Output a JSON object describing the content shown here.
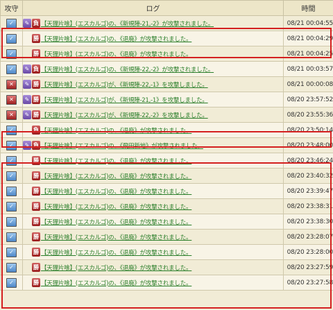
{
  "headers": {
    "attack_defense": "攻守",
    "log": "ログ",
    "time": "時間"
  },
  "rows": [
    {
      "mode": "def",
      "icon": "pen",
      "result": "負",
      "text": "【天狸片喰】(エスカルゴ)の、《新規陣-21,-2》が攻撃されました。",
      "time": "08/21 00:04:55"
    },
    {
      "mode": "def",
      "icon": "",
      "result": "勝",
      "text": "【天狸片喰】(エスカルゴ)の、《退廃》が攻撃されました。",
      "time": "08/21 00:04:29"
    },
    {
      "mode": "def",
      "icon": "",
      "result": "勝",
      "text": "【天狸片喰】(エスカルゴ)の、《退廃》が攻撃されました。",
      "time": "08/21 00:04:25"
    },
    {
      "mode": "def",
      "icon": "pen",
      "result": "負",
      "text": "【天狸片喰】(エスカルゴ)の、《新規陣-22,-2》が攻撃されました。",
      "time": "08/21 00:03:57"
    },
    {
      "mode": "atk",
      "icon": "pen",
      "result": "勝",
      "text": "【天狸片喰】(エスカルゴ)が、《新規陣-22,-1》を攻撃しました。",
      "time": "08/21 00:00:08"
    },
    {
      "mode": "atk",
      "icon": "pen",
      "result": "勝",
      "text": "【天狸片喰】(エスカルゴ)が、《新規陣-21,-1》を攻撃しました。",
      "time": "08/20 23:57:52"
    },
    {
      "mode": "atk",
      "icon": "pen",
      "result": "勝",
      "text": "【天狸片喰】(エスカルゴ)が、《新規陣-22,-2》を攻撃しました。",
      "time": "08/20 23:55:36"
    },
    {
      "mode": "def",
      "icon": "",
      "result": "負",
      "text": "【天狸片喰】(エスカルゴ)の、《退廃》が攻撃されました。",
      "time": "08/20 23:50:14"
    },
    {
      "mode": "def",
      "icon": "pen",
      "result": "負",
      "text": "【天狸片喰】(エスカルゴ)の、《飛田新地》が攻撃されました。",
      "time": "08/20 23:48:00"
    },
    {
      "mode": "def",
      "icon": "",
      "result": "勝",
      "text": "【天狸片喰】(エスカルゴ)の、《退廃》が攻撃されました。",
      "time": "08/20 23:46:24"
    },
    {
      "mode": "def",
      "icon": "",
      "result": "勝",
      "text": "【天狸片喰】(エスカルゴ)の、《退廃》が攻撃されました。",
      "time": "08/20 23:40:32"
    },
    {
      "mode": "def",
      "icon": "",
      "result": "勝",
      "text": "【天狸片喰】(エスカルゴ)の、《退廃》が攻撃されました。",
      "time": "08/20 23:39:47"
    },
    {
      "mode": "def",
      "icon": "",
      "result": "勝",
      "text": "【天狸片喰】(エスカルゴ)の、《退廃》が攻撃されました。",
      "time": "08/20 23:38:31"
    },
    {
      "mode": "def",
      "icon": "",
      "result": "勝",
      "text": "【天狸片喰】(エスカルゴ)の、《退廃》が攻撃されました。",
      "time": "08/20 23:38:30"
    },
    {
      "mode": "def",
      "icon": "",
      "result": "勝",
      "text": "【天狸片喰】(エスカルゴ)の、《退廃》が攻撃されました。",
      "time": "08/20 23:28:07"
    },
    {
      "mode": "def",
      "icon": "",
      "result": "勝",
      "text": "【天狸片喰】(エスカルゴ)の、《退廃》が攻撃されました。",
      "time": "08/20 23:28:00"
    },
    {
      "mode": "def",
      "icon": "",
      "result": "勝",
      "text": "【天狸片喰】(エスカルゴ)の、《退廃》が攻撃されました。",
      "time": "08/20 23:27:59"
    },
    {
      "mode": "def",
      "icon": "",
      "result": "勝",
      "text": "【天狸片喰】(エスカルゴ)の、《退廃》が攻撃されました。",
      "time": "08/20 23:27:58"
    }
  ],
  "colors": {
    "highlight": "#d42020",
    "link_text": "#2b7f2b",
    "result_badge": "#a01c1c",
    "pen_icon": "#6a4aa6"
  },
  "icons": {
    "defense": "shield-check-icon",
    "attack": "crossed-swords-icon",
    "pen": "pen-icon"
  }
}
